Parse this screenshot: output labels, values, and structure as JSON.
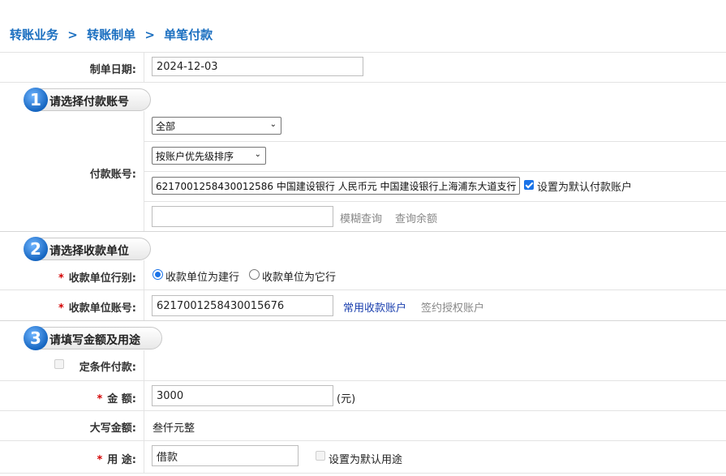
{
  "breadcrumb": {
    "item1": "转账业务",
    "sep1": ">",
    "item2": "转账制单",
    "sep2": ">",
    "item3": "单笔付款"
  },
  "date_row": {
    "label": "制单日期:",
    "value": "2024-12-03"
  },
  "step1": {
    "number": "1",
    "title": "请选择付款账号"
  },
  "payer": {
    "label": "付款账号:",
    "filter_select": "全部",
    "sort_select": "按账户优先级排序",
    "account_select": "6217001258430012586 中国建设银行 人民币元 中国建设银行上海浦东大道支行",
    "default_checkbox_label": "设置为默认付款账户",
    "default_checked": true,
    "search_value": "",
    "fuzzy_query": "模糊查询",
    "balance_query": "查询余额"
  },
  "step2": {
    "number": "2",
    "title": "请选择收款单位"
  },
  "payee_bank_type": {
    "required_mark": "*",
    "label": "收款单位行别:",
    "option_ccb": "收款单位为建行",
    "option_other": "收款单位为它行",
    "selected": "option_ccb"
  },
  "payee_account": {
    "required_mark": "*",
    "label": "收款单位账号:",
    "value": "6217001258430015676",
    "common_accounts": "常用收款账户",
    "signed_accounts": "签约授权账户"
  },
  "step3": {
    "number": "3",
    "title": "请填写金额及用途"
  },
  "conditional": {
    "label": "定条件付款:",
    "checked": false
  },
  "amount": {
    "required_mark": "*",
    "label": "金 额:",
    "value": "3000",
    "unit": "(元)"
  },
  "amount_upper": {
    "label": "大写金额:",
    "value": "叁仟元整"
  },
  "purpose": {
    "required_mark": "*",
    "label": "用 途:",
    "value": "借款",
    "default_label": "设置为默认用途",
    "default_checked": false
  }
}
